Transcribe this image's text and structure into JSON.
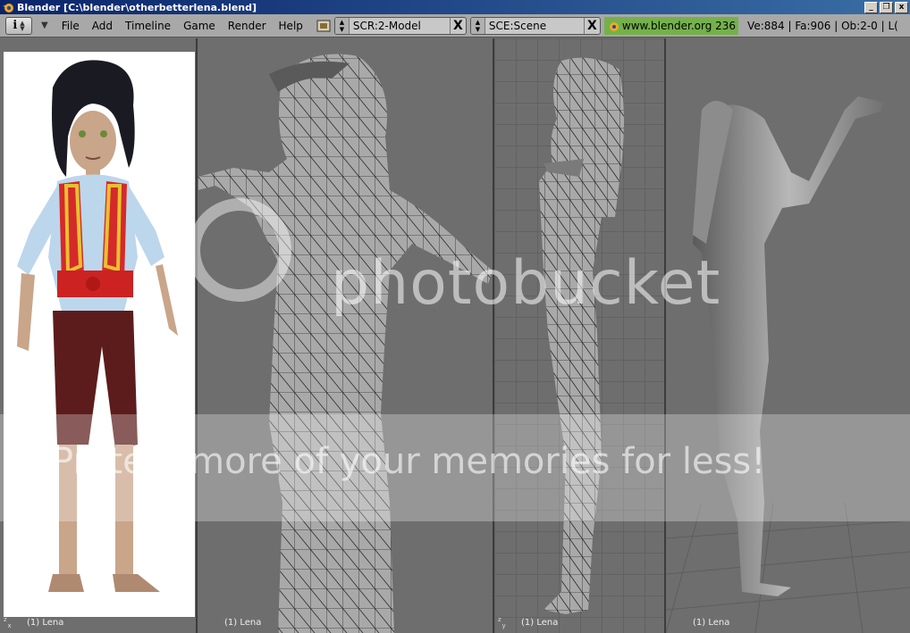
{
  "window": {
    "title": "Blender [C:\\blender\\otherbetterlena.blend]",
    "buttons": [
      "_",
      "❐",
      "x"
    ]
  },
  "header": {
    "menus": [
      "File",
      "Add",
      "Timeline",
      "Game",
      "Render",
      "Help"
    ],
    "screen": "SCR:2-Model",
    "scene": "SCE:Scene",
    "close_glyph": "X",
    "url": "www.blender.org 236",
    "stats": "Ve:884 | Fa:906 | Ob:2-0 | L("
  },
  "viewports": {
    "v1_label": "(1) Lena",
    "v2_label": "(1) Lena",
    "v3_label": "(1) Lena",
    "v4_label": "(1) Lena",
    "v1_axes": "z\nx",
    "v3_axes": "z\ny"
  },
  "watermark": {
    "logo": "photobucket",
    "slogan": "Protect more of your memories for less!"
  },
  "colors": {
    "titlebar": "#0a246a",
    "header": "#a8a8a8",
    "viewport_bg": "#6e6e6e",
    "url_bg": "#74b14a",
    "mesh_fill": "#a9a9a9",
    "mesh_line": "#2a2a2a"
  }
}
